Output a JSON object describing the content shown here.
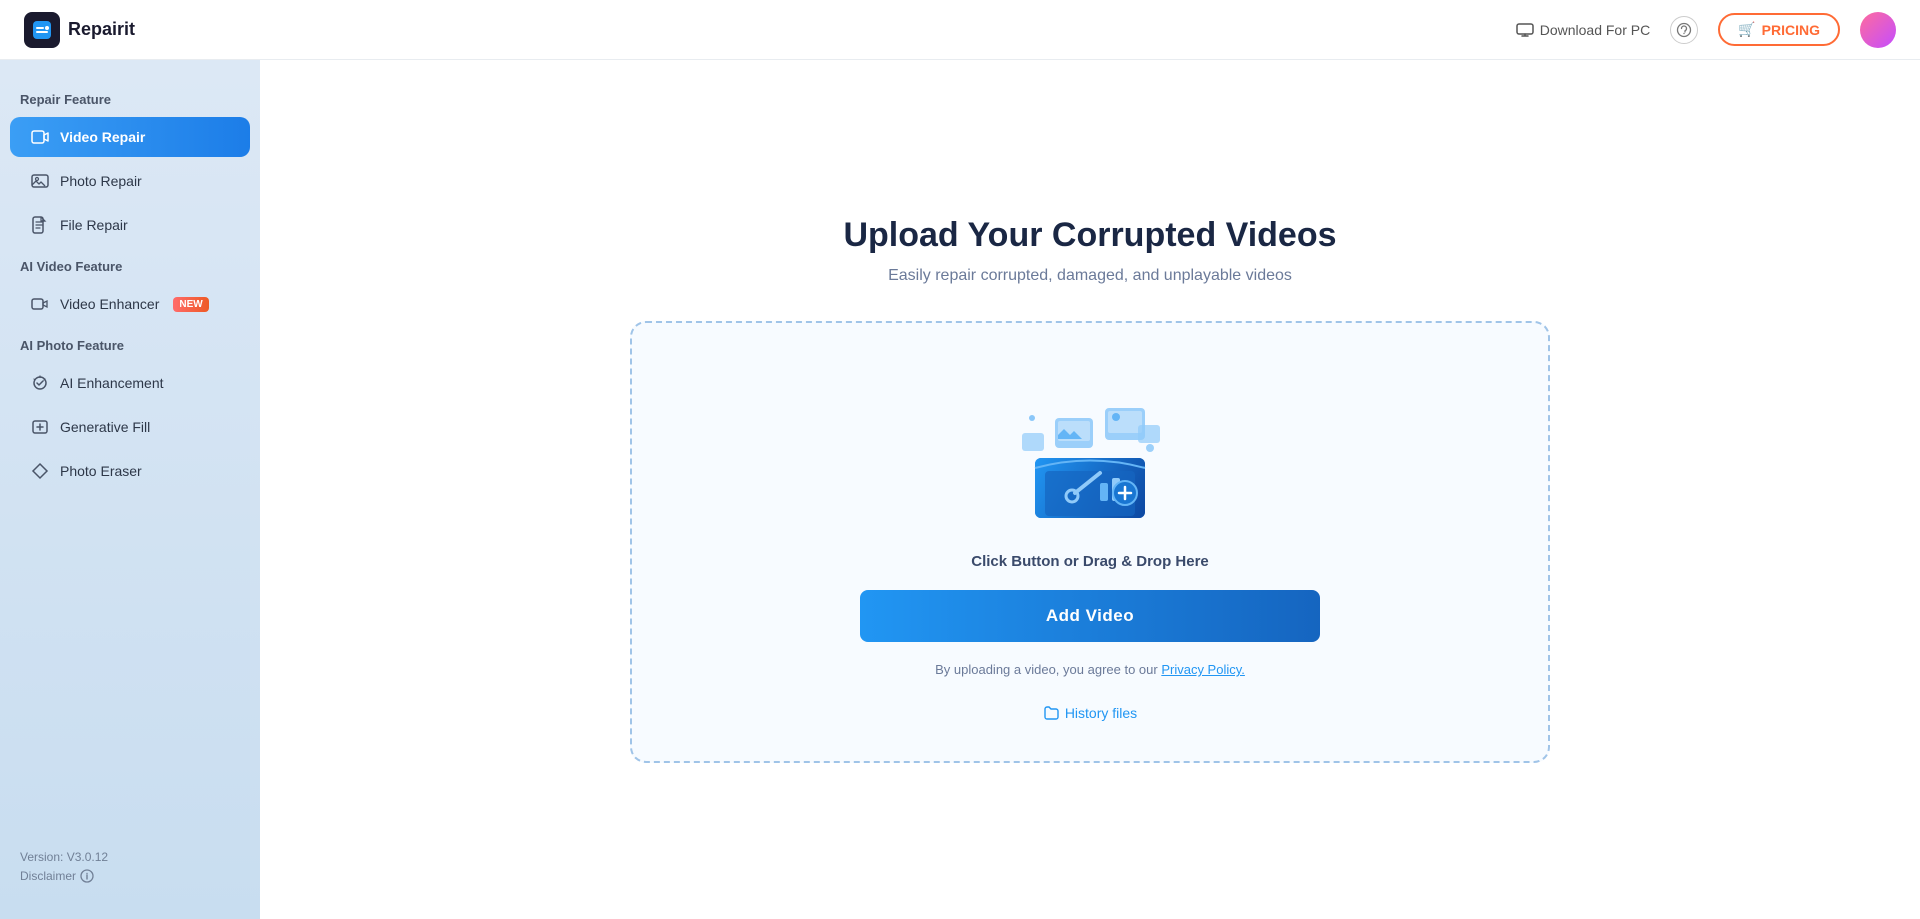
{
  "header": {
    "logo_text": "Repairit",
    "download_label": "Download For PC",
    "pricing_label": "PRICING",
    "pricing_icon": "🛒"
  },
  "sidebar": {
    "repair_feature_label": "Repair Feature",
    "ai_video_feature_label": "AI Video Feature",
    "ai_photo_feature_label": "AI Photo Feature",
    "items": [
      {
        "id": "video-repair",
        "label": "Video Repair",
        "active": true,
        "icon": "▶"
      },
      {
        "id": "photo-repair",
        "label": "Photo Repair",
        "active": false,
        "icon": "🖼"
      },
      {
        "id": "file-repair",
        "label": "File Repair",
        "active": false,
        "icon": "📄"
      },
      {
        "id": "video-enhancer",
        "label": "Video Enhancer",
        "active": false,
        "icon": "🎬",
        "badge": "NEW"
      },
      {
        "id": "ai-enhancement",
        "label": "AI Enhancement",
        "active": false,
        "icon": "✨"
      },
      {
        "id": "generative-fill",
        "label": "Generative Fill",
        "active": false,
        "icon": "💎"
      },
      {
        "id": "photo-eraser",
        "label": "Photo Eraser",
        "active": false,
        "icon": "⬡"
      }
    ],
    "version_text": "Version: V3.0.12",
    "disclaimer_text": "Disclaimer"
  },
  "main": {
    "title": "Upload Your Corrupted Videos",
    "subtitle": "Easily repair corrupted, damaged, and unplayable videos",
    "upload_hint": "Click Button or Drag & Drop Here",
    "add_video_label": "Add Video",
    "privacy_prefix": "By uploading a video, you agree to our ",
    "privacy_link": "Privacy Policy.",
    "history_label": "History files"
  }
}
